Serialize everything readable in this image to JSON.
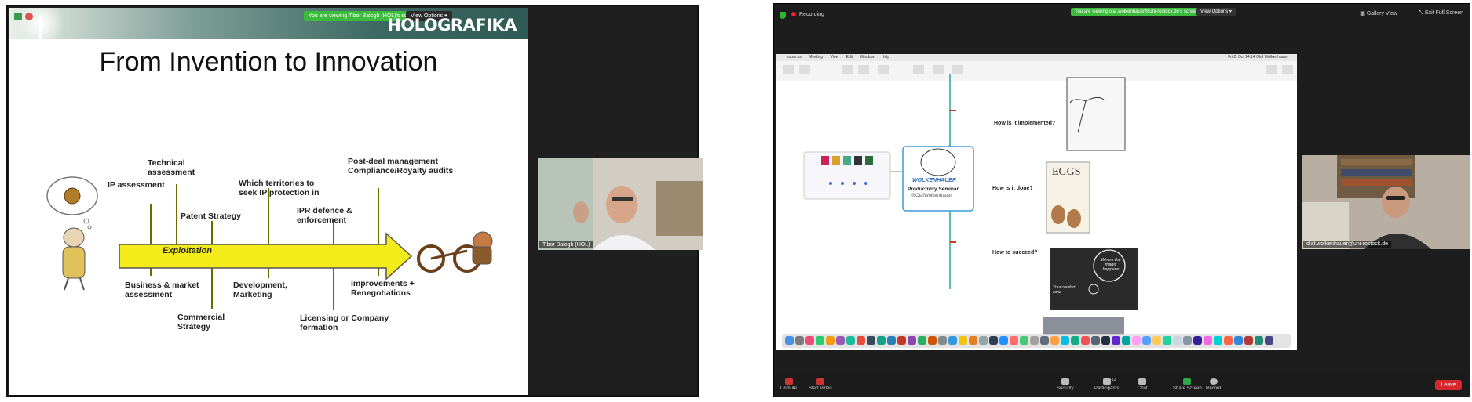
{
  "left": {
    "banner": "You are viewing Tibor Balogh (HOL)'s screen",
    "view_options": "View Options",
    "slide": {
      "logo": "HOLOGRAFIKA",
      "title": "From Invention to Innovation",
      "arrow_label": "Exploitation",
      "labels_top": [
        "IP assessment",
        "Technical assessment",
        "Patent Strategy",
        "Which territories to seek IP protection in",
        "IPR defence & enforcement",
        "Post-deal management Compliance/Royalty audits"
      ],
      "labels_bottom": [
        "Business & market assessment",
        "Commercial Strategy",
        "Development, Marketing",
        "Licensing or Company formation",
        "Improvements + Renegotiations"
      ]
    },
    "participant": "Tibor Balogh (HOL)"
  },
  "right": {
    "recording": "Recording",
    "banner": "You are viewing olaf.wolkenhauer@uni-rostock.de's screen",
    "view_options": "View Options",
    "gallery_view": "Gallery View",
    "exit_full_screen": "Exit Full Screen",
    "menubar": [
      "zoom.us",
      "Meeting",
      "View",
      "Edit",
      "Window",
      "Help"
    ],
    "menubar_right": "Fri 2. Oct 14:14   Olaf Wolkenhauer",
    "mindmap": {
      "center_title": "Productivity Seminar",
      "center_handle": "@OlafWolkenhauer",
      "center_brand": "WOLKENHAUER",
      "q1": "How is it implemented?",
      "q2": "How is it done?",
      "q3": "How to succeed?",
      "book_title": "EGGS",
      "chalk_big": "Where the magic happens",
      "chalk_small": "Your comfort zone"
    },
    "participant": "olaf.wolkenhauer@uni-rostock.de",
    "bottom_bar": {
      "unmute": "Unmute",
      "start_video": "Start Video",
      "security": "Security",
      "participants": "Participants",
      "participants_count": "12",
      "chat": "Chat",
      "share_screen": "Share Screen",
      "record": "Record",
      "leave": "Leave"
    }
  }
}
